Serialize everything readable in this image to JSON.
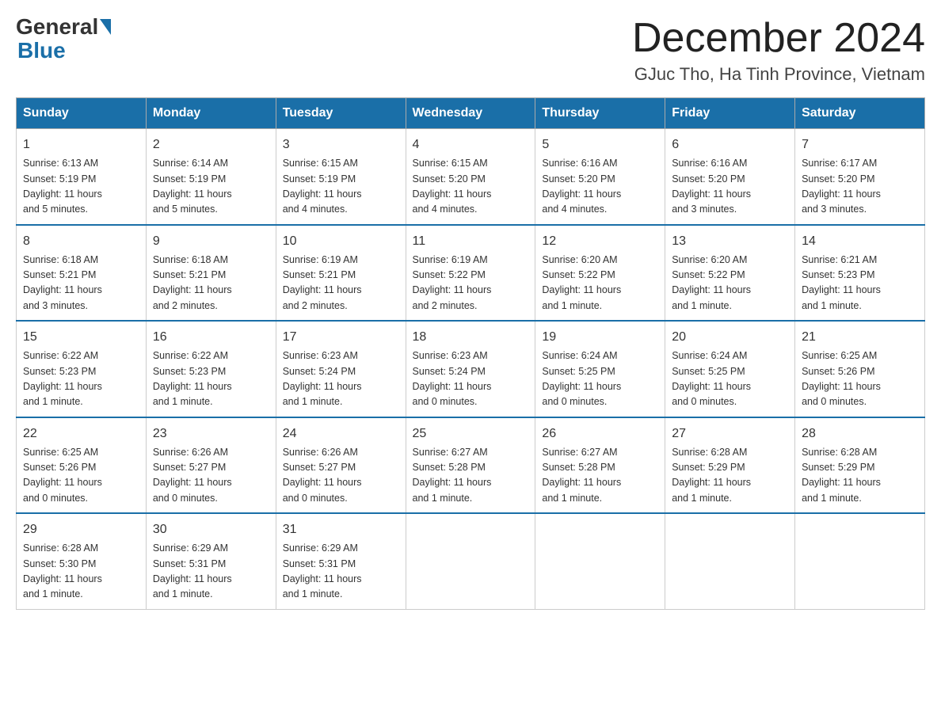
{
  "header": {
    "logo": {
      "general": "General",
      "blue": "Blue"
    },
    "title": "December 2024",
    "location": "GJuc Tho, Ha Tinh Province, Vietnam"
  },
  "days_of_week": [
    "Sunday",
    "Monday",
    "Tuesday",
    "Wednesday",
    "Thursday",
    "Friday",
    "Saturday"
  ],
  "weeks": [
    {
      "days": [
        {
          "date": "1",
          "sunrise": "6:13 AM",
          "sunset": "5:19 PM",
          "daylight": "11 hours and 5 minutes."
        },
        {
          "date": "2",
          "sunrise": "6:14 AM",
          "sunset": "5:19 PM",
          "daylight": "11 hours and 5 minutes."
        },
        {
          "date": "3",
          "sunrise": "6:15 AM",
          "sunset": "5:19 PM",
          "daylight": "11 hours and 4 minutes."
        },
        {
          "date": "4",
          "sunrise": "6:15 AM",
          "sunset": "5:20 PM",
          "daylight": "11 hours and 4 minutes."
        },
        {
          "date": "5",
          "sunrise": "6:16 AM",
          "sunset": "5:20 PM",
          "daylight": "11 hours and 4 minutes."
        },
        {
          "date": "6",
          "sunrise": "6:16 AM",
          "sunset": "5:20 PM",
          "daylight": "11 hours and 3 minutes."
        },
        {
          "date": "7",
          "sunrise": "6:17 AM",
          "sunset": "5:20 PM",
          "daylight": "11 hours and 3 minutes."
        }
      ]
    },
    {
      "days": [
        {
          "date": "8",
          "sunrise": "6:18 AM",
          "sunset": "5:21 PM",
          "daylight": "11 hours and 3 minutes."
        },
        {
          "date": "9",
          "sunrise": "6:18 AM",
          "sunset": "5:21 PM",
          "daylight": "11 hours and 2 minutes."
        },
        {
          "date": "10",
          "sunrise": "6:19 AM",
          "sunset": "5:21 PM",
          "daylight": "11 hours and 2 minutes."
        },
        {
          "date": "11",
          "sunrise": "6:19 AM",
          "sunset": "5:22 PM",
          "daylight": "11 hours and 2 minutes."
        },
        {
          "date": "12",
          "sunrise": "6:20 AM",
          "sunset": "5:22 PM",
          "daylight": "11 hours and 1 minute."
        },
        {
          "date": "13",
          "sunrise": "6:20 AM",
          "sunset": "5:22 PM",
          "daylight": "11 hours and 1 minute."
        },
        {
          "date": "14",
          "sunrise": "6:21 AM",
          "sunset": "5:23 PM",
          "daylight": "11 hours and 1 minute."
        }
      ]
    },
    {
      "days": [
        {
          "date": "15",
          "sunrise": "6:22 AM",
          "sunset": "5:23 PM",
          "daylight": "11 hours and 1 minute."
        },
        {
          "date": "16",
          "sunrise": "6:22 AM",
          "sunset": "5:23 PM",
          "daylight": "11 hours and 1 minute."
        },
        {
          "date": "17",
          "sunrise": "6:23 AM",
          "sunset": "5:24 PM",
          "daylight": "11 hours and 1 minute."
        },
        {
          "date": "18",
          "sunrise": "6:23 AM",
          "sunset": "5:24 PM",
          "daylight": "11 hours and 0 minutes."
        },
        {
          "date": "19",
          "sunrise": "6:24 AM",
          "sunset": "5:25 PM",
          "daylight": "11 hours and 0 minutes."
        },
        {
          "date": "20",
          "sunrise": "6:24 AM",
          "sunset": "5:25 PM",
          "daylight": "11 hours and 0 minutes."
        },
        {
          "date": "21",
          "sunrise": "6:25 AM",
          "sunset": "5:26 PM",
          "daylight": "11 hours and 0 minutes."
        }
      ]
    },
    {
      "days": [
        {
          "date": "22",
          "sunrise": "6:25 AM",
          "sunset": "5:26 PM",
          "daylight": "11 hours and 0 minutes."
        },
        {
          "date": "23",
          "sunrise": "6:26 AM",
          "sunset": "5:27 PM",
          "daylight": "11 hours and 0 minutes."
        },
        {
          "date": "24",
          "sunrise": "6:26 AM",
          "sunset": "5:27 PM",
          "daylight": "11 hours and 0 minutes."
        },
        {
          "date": "25",
          "sunrise": "6:27 AM",
          "sunset": "5:28 PM",
          "daylight": "11 hours and 1 minute."
        },
        {
          "date": "26",
          "sunrise": "6:27 AM",
          "sunset": "5:28 PM",
          "daylight": "11 hours and 1 minute."
        },
        {
          "date": "27",
          "sunrise": "6:28 AM",
          "sunset": "5:29 PM",
          "daylight": "11 hours and 1 minute."
        },
        {
          "date": "28",
          "sunrise": "6:28 AM",
          "sunset": "5:29 PM",
          "daylight": "11 hours and 1 minute."
        }
      ]
    },
    {
      "days": [
        {
          "date": "29",
          "sunrise": "6:28 AM",
          "sunset": "5:30 PM",
          "daylight": "11 hours and 1 minute."
        },
        {
          "date": "30",
          "sunrise": "6:29 AM",
          "sunset": "5:31 PM",
          "daylight": "11 hours and 1 minute."
        },
        {
          "date": "31",
          "sunrise": "6:29 AM",
          "sunset": "5:31 PM",
          "daylight": "11 hours and 1 minute."
        },
        null,
        null,
        null,
        null
      ]
    }
  ],
  "labels": {
    "sunrise": "Sunrise:",
    "sunset": "Sunset:",
    "daylight": "Daylight:"
  }
}
